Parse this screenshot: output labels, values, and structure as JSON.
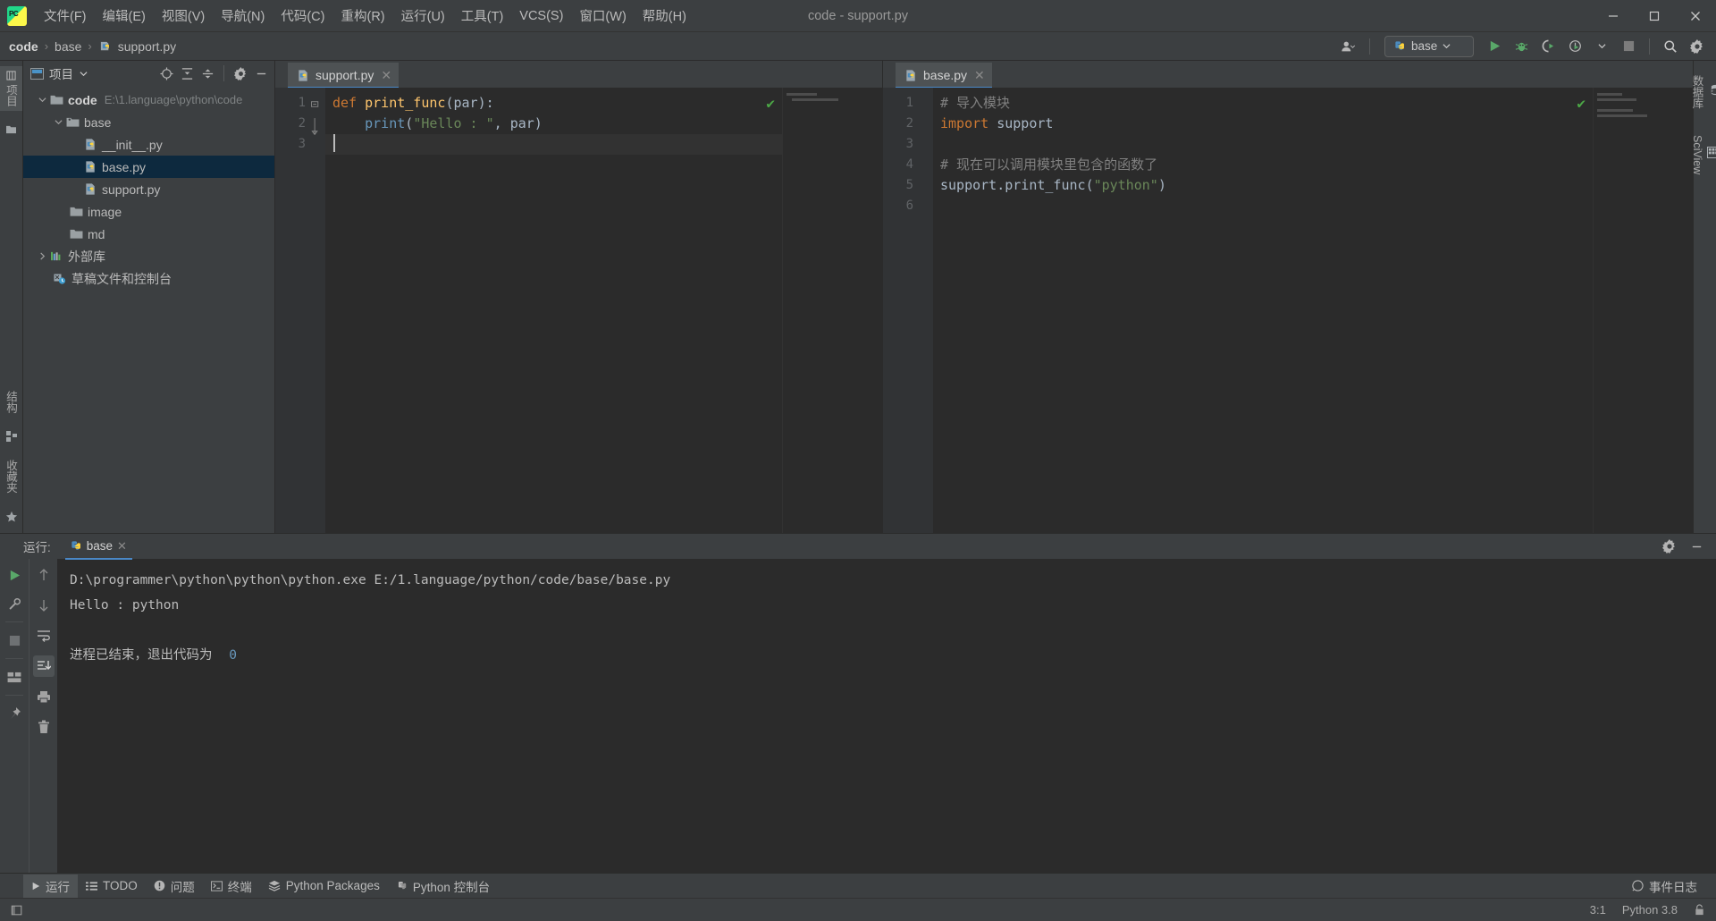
{
  "window": {
    "title": "code - support.py",
    "minimize": "—",
    "maximize": "▢",
    "close": "✕"
  },
  "menu": {
    "items": [
      "文件(F)",
      "编辑(E)",
      "视图(V)",
      "导航(N)",
      "代码(C)",
      "重构(R)",
      "运行(U)",
      "工具(T)",
      "VCS(S)",
      "窗口(W)",
      "帮助(H)"
    ]
  },
  "breadcrumb": {
    "project": "code",
    "folder": "base",
    "file": "support.py",
    "separator": "›"
  },
  "toolbar": {
    "run_config": "base",
    "icons": [
      "user-icon",
      "run-icon",
      "debug-icon",
      "coverage-icon",
      "profile-icon",
      "stop-icon",
      "search-icon",
      "settings-icon"
    ]
  },
  "left_strip": {
    "project_tab": "项目",
    "structure_tab": "结构",
    "favorites_tab": "收藏夹"
  },
  "right_strip": {
    "database_tab": "数据库",
    "sciview_tab": "SciView"
  },
  "project_panel": {
    "title": "项目",
    "tools": [
      "locate-icon",
      "expand-all-icon",
      "collapse-all-icon",
      "settings-icon",
      "hide-icon"
    ],
    "tree": [
      {
        "label": "code",
        "path": "E:\\1.language\\python\\code",
        "indent": 0,
        "icon": "folder-icon",
        "twist": "expanded",
        "bold": true,
        "selected": false
      },
      {
        "label": "base",
        "path": "",
        "indent": 1,
        "icon": "source-folder-icon",
        "twist": "expanded",
        "bold": false,
        "selected": false
      },
      {
        "label": "__init__.py",
        "path": "",
        "indent": 2,
        "icon": "python-file-icon",
        "twist": "none",
        "bold": false,
        "selected": false
      },
      {
        "label": "base.py",
        "path": "",
        "indent": 2,
        "icon": "python-file-icon",
        "twist": "none",
        "bold": false,
        "selected": true
      },
      {
        "label": "support.py",
        "path": "",
        "indent": 2,
        "icon": "python-file-icon",
        "twist": "none",
        "bold": false,
        "selected": false
      },
      {
        "label": "image",
        "path": "",
        "indent": 1,
        "icon": "folder-icon",
        "twist": "none",
        "bold": false,
        "selected": false
      },
      {
        "label": "md",
        "path": "",
        "indent": 1,
        "icon": "folder-icon",
        "twist": "none",
        "bold": false,
        "selected": false
      },
      {
        "label": "外部库",
        "path": "",
        "indent": 0,
        "icon": "library-icon",
        "twist": "collapsed",
        "bold": false,
        "selected": false
      },
      {
        "label": "草稿文件和控制台",
        "path": "",
        "indent": 0,
        "icon": "scratch-icon",
        "twist": "none",
        "bold": false,
        "selected": false
      }
    ]
  },
  "editor_left": {
    "tab_label": "support.py",
    "tab_close": "✕",
    "inspection": "✔",
    "lines": [
      "1",
      "2",
      "3"
    ],
    "cursor_line": 3,
    "code": [
      [
        {
          "t": "def ",
          "c": "kw"
        },
        {
          "t": "print_func",
          "c": "fn"
        },
        {
          "t": "(",
          "c": "pct"
        },
        {
          "t": "par",
          "c": "id"
        },
        {
          "t": "):",
          "c": "pct"
        }
      ],
      [
        {
          "t": "    ",
          "c": "id"
        },
        {
          "t": "print",
          "c": "num"
        },
        {
          "t": "(",
          "c": "pct"
        },
        {
          "t": "\"Hello : \"",
          "c": "str"
        },
        {
          "t": ", ",
          "c": "pct"
        },
        {
          "t": "par",
          "c": "id"
        },
        {
          "t": ")",
          "c": "pct"
        }
      ],
      [
        {
          "t": "",
          "c": "id"
        }
      ]
    ]
  },
  "editor_right": {
    "tab_label": "base.py",
    "tab_close": "✕",
    "inspection": "✔",
    "lines": [
      "1",
      "2",
      "3",
      "4",
      "5",
      "6"
    ],
    "code": [
      [
        {
          "t": "# 导入模块",
          "c": "cmt"
        }
      ],
      [
        {
          "t": "import ",
          "c": "kw"
        },
        {
          "t": "support",
          "c": "id"
        }
      ],
      [
        {
          "t": "",
          "c": "id"
        }
      ],
      [
        {
          "t": "# 现在可以调用模块里包含的函数了",
          "c": "cmt"
        }
      ],
      [
        {
          "t": "support",
          "c": "id"
        },
        {
          "t": ".",
          "c": "pct"
        },
        {
          "t": "print_func",
          "c": "id"
        },
        {
          "t": "(",
          "c": "pct"
        },
        {
          "t": "\"python\"",
          "c": "str"
        },
        {
          "t": ")",
          "c": "pct"
        }
      ],
      [
        {
          "t": "",
          "c": "id"
        }
      ]
    ]
  },
  "run_panel": {
    "label": "运行:",
    "tab": "base",
    "tab_close": "✕",
    "settings_icon": "gear-icon",
    "hide_icon": "minimize-icon",
    "console": {
      "command": "D:\\programmer\\python\\python\\python.exe E:/1.language/python/code/base/base.py",
      "output": "Hello :  python",
      "exit_text": "进程已结束，退出代码为",
      "exit_code": "0"
    },
    "tools_left": [
      "rerun-icon",
      "wrench-icon",
      "stop-icon",
      "layout-icon",
      "pin-icon"
    ],
    "tools_right": [
      "up-arrow-icon",
      "down-arrow-icon",
      "soft-wrap-icon",
      "scroll-to-end-icon",
      "print-icon",
      "trash-icon"
    ]
  },
  "bottom_bar": {
    "items": [
      {
        "label": "运行",
        "icon": "play-icon",
        "active": true
      },
      {
        "label": "TODO",
        "icon": "list-icon",
        "active": false
      },
      {
        "label": "问题",
        "icon": "warning-icon",
        "active": false
      },
      {
        "label": "终端",
        "icon": "terminal-icon",
        "active": false
      },
      {
        "label": "Python Packages",
        "icon": "packages-icon",
        "active": false
      },
      {
        "label": "Python 控制台",
        "icon": "python-icon",
        "active": false
      }
    ],
    "event_log": "事件日志"
  },
  "status_bar": {
    "caret": "3:1",
    "interpreter": "Python 3.8",
    "lock_icon": "lock-icon"
  },
  "colors": {
    "accent_blue": "#4a88c7",
    "selection": "#0d293e",
    "panel_bg": "#3c3f41",
    "editor_bg": "#2b2b2b",
    "keyword": "#cc7832",
    "string": "#6a8759",
    "function": "#ffc66d",
    "comment": "#808080",
    "number": "#6897bb",
    "ok_green": "#4ca746"
  }
}
